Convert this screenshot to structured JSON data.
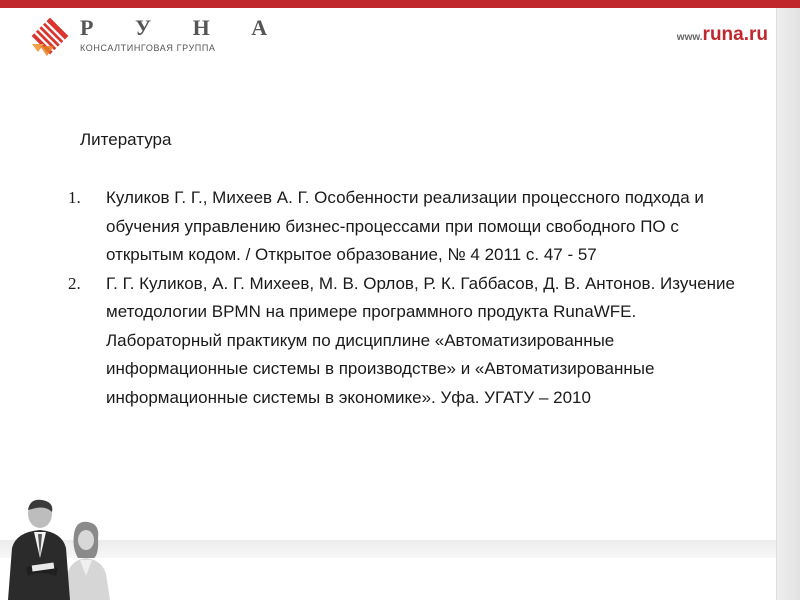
{
  "header": {
    "logo_title": "Р У Н А",
    "logo_subtitle": "КОНСАЛТИНГОВАЯ ГРУППА",
    "url_prefix": "www.",
    "url_domain": "runa.ru"
  },
  "main": {
    "heading": "Литература",
    "references": [
      {
        "number": "1.",
        "text": "Куликов Г. Г., Михеев А. Г. Особенности реализации процессного подхода и обучения управлению бизнес-процессами при помощи свободного ПО с открытым кодом. / Открытое образование, № 4 2011 с. 47 - 57"
      },
      {
        "number": "2.",
        "text": "Г. Г. Куликов, А. Г. Михеев, М. В. Орлов, Р. К. Габбасов, Д. В. Антонов. Изучение методологии BPMN на примере программного продукта RunaWFE. Лабораторный практикум по дисциплине «Автоматизированные информационные системы в производстве» и «Автоматизированные информационные системы в экономике». Уфа. УГАТУ – 2010"
      }
    ]
  },
  "colors": {
    "brand_red": "#c0272d",
    "text": "#1a1a1a",
    "logo_gray": "#555555"
  },
  "icons": {
    "logo_mark": "runa-logo-mark-icon",
    "photo": "business-people-photo"
  }
}
